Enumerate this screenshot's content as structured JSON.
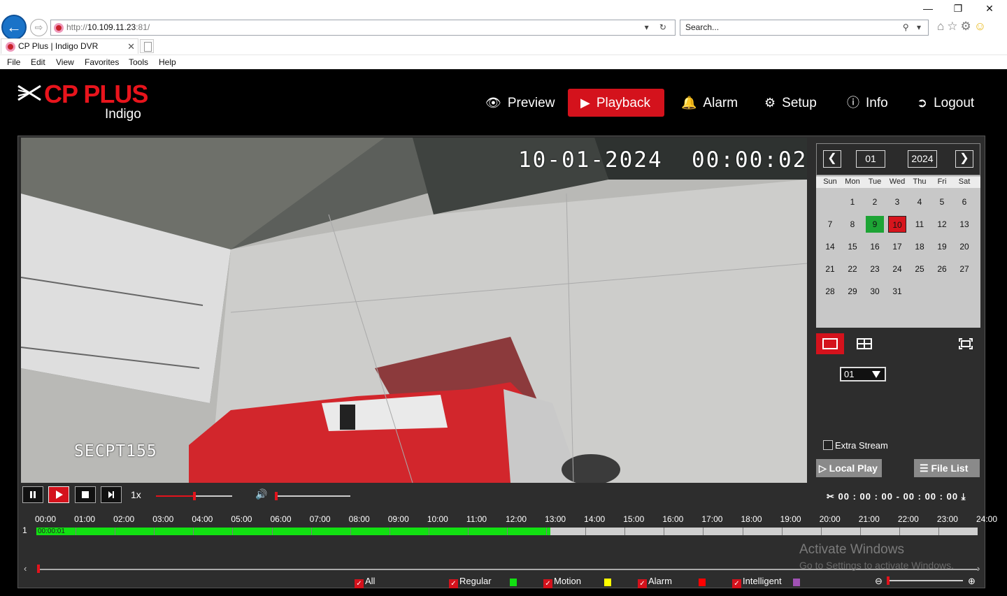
{
  "browser": {
    "address_prefix": "http://",
    "address_host": "10.109.11.23",
    "address_suffix": ":81/",
    "search_placeholder": "Search...",
    "tab_title": "CP Plus | Indigo DVR",
    "menu": [
      "File",
      "Edit",
      "View",
      "Favorites",
      "Tools",
      "Help"
    ]
  },
  "app": {
    "brand": "CP PLUS",
    "product": "Indigo",
    "brand_color": "#e8141c",
    "nav": [
      {
        "label": "Preview",
        "icon": "eye-icon"
      },
      {
        "label": "Playback",
        "icon": "play-circle-icon",
        "active": true
      },
      {
        "label": "Alarm",
        "icon": "bell-icon"
      },
      {
        "label": "Setup",
        "icon": "gear-icon"
      },
      {
        "label": "Info",
        "icon": "info-icon"
      },
      {
        "label": "Logout",
        "icon": "logout-icon"
      }
    ]
  },
  "video": {
    "osd_timestamp": "10-01-2024  00:00:02",
    "osd_camera_name": "SECPT155"
  },
  "calendar": {
    "month": "01",
    "year": "2024",
    "weekdays": [
      "Sun",
      "Mon",
      "Tue",
      "Wed",
      "Thu",
      "Fri",
      "Sat"
    ],
    "weeks": [
      [
        "",
        "1",
        "2",
        "3",
        "4",
        "5",
        "6"
      ],
      [
        "7",
        "8",
        "9",
        "10",
        "11",
        "12",
        "13"
      ],
      [
        "14",
        "15",
        "16",
        "17",
        "18",
        "19",
        "20"
      ],
      [
        "21",
        "22",
        "23",
        "24",
        "25",
        "26",
        "27"
      ],
      [
        "28",
        "29",
        "30",
        "31",
        "",
        "",
        ""
      ]
    ],
    "recorded_day": "9",
    "selected_day": "10",
    "recorded_color": "#1da435",
    "selected_color": "#d7151d"
  },
  "sidebar": {
    "channel": "01",
    "extra_stream_label": "Extra Stream",
    "extra_stream_checked": false,
    "local_play_label": "Local Play",
    "file_list_label": "File List"
  },
  "controls": {
    "speed": "1x",
    "clip_time": "00 : 00 : 00 - 00 : 00 : 00",
    "progress_fraction": 0.5,
    "volume_fraction": 0.0
  },
  "timeline": {
    "hours": [
      "00:00",
      "01:00",
      "02:00",
      "03:00",
      "04:00",
      "05:00",
      "06:00",
      "07:00",
      "08:00",
      "09:00",
      "10:00",
      "11:00",
      "12:00",
      "13:00",
      "14:00",
      "15:00",
      "16:00",
      "17:00",
      "18:00",
      "19:00",
      "20:00",
      "21:00",
      "22:00",
      "23:00",
      "24:00"
    ],
    "channel_label": "1",
    "start_label": "00:00:01",
    "recorded_until_hour": 13.1,
    "recording_color": "#12e012"
  },
  "legend": [
    {
      "label": "All",
      "checked": true
    },
    {
      "label": "Regular",
      "checked": true,
      "color": "#12e012"
    },
    {
      "label": "Motion",
      "checked": true,
      "color": "#ffff00"
    },
    {
      "label": "Alarm",
      "checked": true,
      "color": "#ff0000"
    },
    {
      "label": "Intelligent",
      "checked": true,
      "color": "#a052b4"
    }
  ],
  "watermark": {
    "title": "Activate Windows",
    "subtitle": "Go to Settings to activate Windows."
  }
}
